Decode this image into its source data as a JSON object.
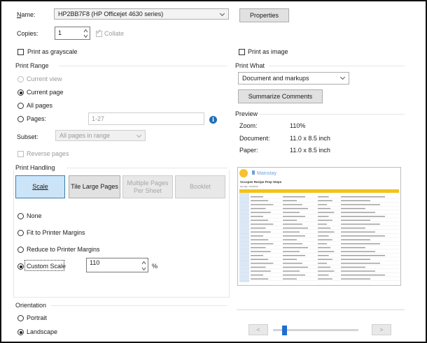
{
  "printer": {
    "name_label": "Name:",
    "name_value": "HP2BB7F8 (HP Officejet 4630 series)",
    "properties_label": "Properties",
    "copies_label": "Copies:",
    "copies_value": "1",
    "collate_label": "Collate",
    "grayscale_label": "Print as grayscale",
    "as_image_label": "Print as image"
  },
  "print_range": {
    "title": "Print Range",
    "current_view": "Current view",
    "current_page": "Current page",
    "all_pages": "All pages",
    "pages": "Pages:",
    "pages_value": "1-27",
    "subset_label": "Subset:",
    "subset_value": "All pages in range",
    "reverse_pages": "Reverse pages"
  },
  "print_what": {
    "title": "Print What",
    "value": "Document and markups",
    "summarize_label": "Summarize Comments"
  },
  "preview": {
    "title": "Preview",
    "zoom_label": "Zoom:",
    "zoom_value": "110%",
    "document_label": "Document:",
    "document_value": "11.0 x 8.5 inch",
    "paper_label": "Paper:",
    "paper_value": "11.0 x 8.5 inch",
    "thumb": {
      "brand": "Mainstay",
      "heading": "Vccopee Recipe Prep Steps",
      "subheading": "Monday, 7/23/2018"
    }
  },
  "print_handling": {
    "title": "Print Handling",
    "scale_label": "Scale",
    "tile_label": "Tile Large Pages",
    "multiple_label": "Multiple Pages Per Sheet",
    "booklet_label": "Booklet",
    "none_label": "None",
    "fit_label": "Fit to Printer Margins",
    "reduce_label": "Reduce to Printer Margins",
    "custom_label": "Custom Scale",
    "custom_value": "110",
    "percent": "%"
  },
  "orientation": {
    "title": "Orientation",
    "portrait": "Portrait",
    "landscape": "Landscape"
  },
  "nav": {
    "prev": "<",
    "next": ">"
  },
  "colors": {
    "accent": "#1f6fd1",
    "active_fill": "#cce4f7",
    "info": "#1f6fb5"
  }
}
